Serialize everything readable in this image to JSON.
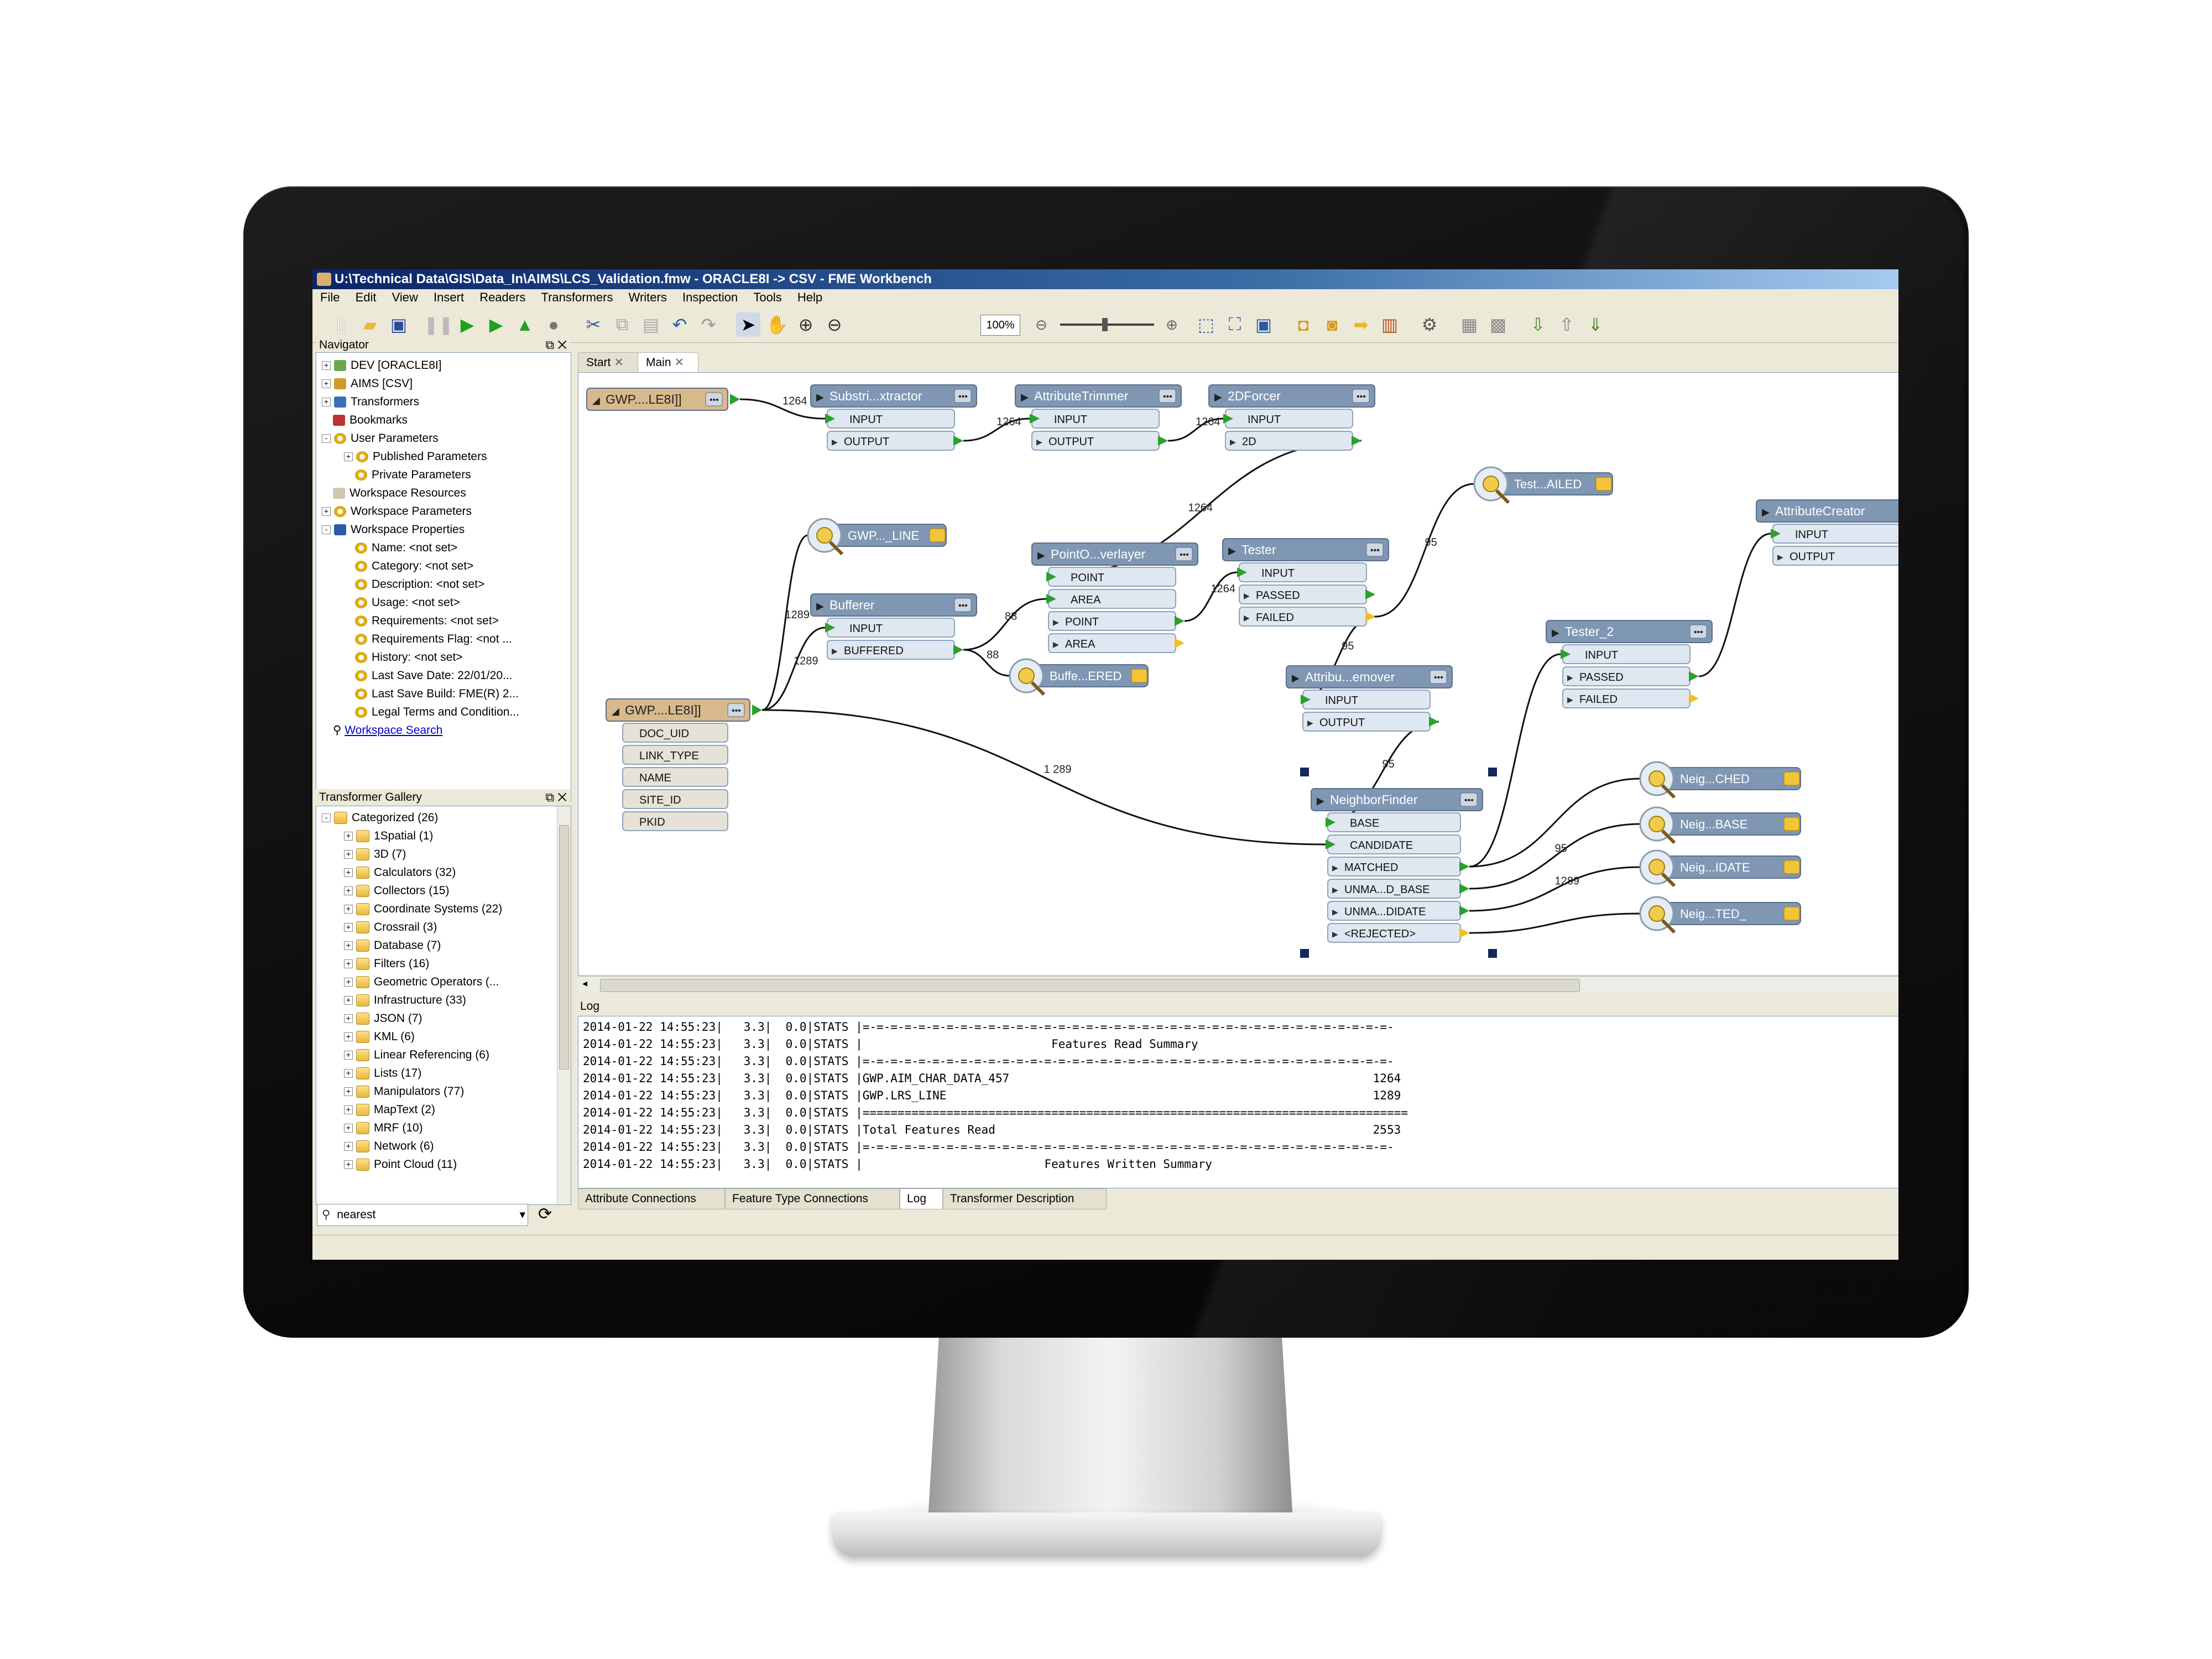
{
  "window": {
    "title": "U:\\Technical Data\\GIS\\Data_In\\AIMS\\LCS_Validation.fmw - ORACLE8I -> CSV - FME Workbench"
  },
  "menu": [
    "File",
    "Edit",
    "View",
    "Insert",
    "Readers",
    "Transformers",
    "Writers",
    "Inspection",
    "Tools",
    "Help"
  ],
  "toolbar": {
    "zoom_value": "100%",
    "icons": [
      "new-icon",
      "open-icon",
      "save-icon",
      "pause-icon",
      "run-icon",
      "run-to-icon",
      "run-partial-icon",
      "stop-icon",
      "cut-icon",
      "copy-icon",
      "paste-icon",
      "undo-icon",
      "redo-icon",
      "select-icon",
      "pan-icon",
      "zoom-in-icon",
      "zoom-out-icon",
      "zoom-extents-icon",
      "zoom-fit-icon",
      "zoom-window-icon",
      "add-reader-icon",
      "add-writer-icon",
      "add-transformer-icon",
      "add-bookmark-icon",
      "inspect-icon",
      "align-icon",
      "distribute-icon",
      "import-icon",
      "export-icon",
      "publish-icon"
    ]
  },
  "navigator": {
    "title": "Navigator",
    "items": [
      {
        "label": "DEV [ORACLE8I]",
        "indent": 0,
        "icon": "reader",
        "exp": "+"
      },
      {
        "label": "AIMS [CSV]",
        "indent": 0,
        "icon": "writer",
        "exp": "+"
      },
      {
        "label": "Transformers",
        "indent": 0,
        "icon": "transf",
        "exp": "+"
      },
      {
        "label": "Bookmarks",
        "indent": 0,
        "icon": "book",
        "exp": ""
      },
      {
        "label": "User Parameters",
        "indent": 0,
        "icon": "gear",
        "exp": "-"
      },
      {
        "label": "Published Parameters",
        "indent": 1,
        "icon": "gear",
        "exp": "+"
      },
      {
        "label": "Private Parameters",
        "indent": 1,
        "icon": "gear",
        "exp": ""
      },
      {
        "label": "Workspace Resources",
        "indent": 0,
        "icon": "doc",
        "exp": ""
      },
      {
        "label": "Workspace Parameters",
        "indent": 0,
        "icon": "gear",
        "exp": "+"
      },
      {
        "label": "Workspace Properties",
        "indent": 0,
        "icon": "info",
        "exp": "-"
      },
      {
        "label": "Name: <not set>",
        "indent": 1,
        "icon": "gear",
        "exp": ""
      },
      {
        "label": "Category: <not set>",
        "indent": 1,
        "icon": "gear",
        "exp": ""
      },
      {
        "label": "Description: <not set>",
        "indent": 1,
        "icon": "gear",
        "exp": ""
      },
      {
        "label": "Usage: <not set>",
        "indent": 1,
        "icon": "gear",
        "exp": ""
      },
      {
        "label": "Requirements: <not set>",
        "indent": 1,
        "icon": "gear",
        "exp": ""
      },
      {
        "label": "Requirements Flag: <not ...",
        "indent": 1,
        "icon": "gear",
        "exp": ""
      },
      {
        "label": "History: <not set>",
        "indent": 1,
        "icon": "gear",
        "exp": ""
      },
      {
        "label": "Last Save Date: 22/01/20...",
        "indent": 1,
        "icon": "gear",
        "exp": ""
      },
      {
        "label": "Last Save Build: FME(R) 2...",
        "indent": 1,
        "icon": "gear",
        "exp": ""
      },
      {
        "label": "Legal Terms and Condition...",
        "indent": 1,
        "icon": "gear",
        "exp": ""
      }
    ],
    "search_link": "Workspace Search"
  },
  "gallery": {
    "title": "Transformer Gallery",
    "root": "Categorized (26)",
    "items": [
      "1Spatial (1)",
      "3D (7)",
      "Calculators (32)",
      "Collectors (15)",
      "Coordinate Systems (22)",
      "Crossrail (3)",
      "Database (7)",
      "Filters (16)",
      "Geometric Operators (...",
      "Infrastructure (33)",
      "JSON (7)",
      "KML (6)",
      "Linear Referencing (6)",
      "Lists (17)",
      "Manipulators (77)",
      "MapText (2)",
      "MRF (10)",
      "Network (6)",
      "Point Cloud (11)"
    ],
    "search_value": "nearest"
  },
  "tabs": [
    "Start",
    "Main"
  ],
  "workflow": {
    "nodes": [
      {
        "id": "reader1",
        "title": "GWP....LE8I]]",
        "kind": "reader",
        "ports": []
      },
      {
        "id": "substr",
        "title": "Substri...xtractor",
        "kind": "transformer",
        "ports": [
          "INPUT",
          "OUTPUT"
        ]
      },
      {
        "id": "attrtrim",
        "title": "AttributeTrimmer",
        "kind": "transformer",
        "ports": [
          "INPUT",
          "OUTPUT"
        ]
      },
      {
        "id": "forcer",
        "title": "2DForcer",
        "kind": "transformer",
        "ports": [
          "INPUT",
          "2D"
        ]
      },
      {
        "id": "insp1",
        "title": "GWP..._LINE",
        "kind": "inspector",
        "ports": []
      },
      {
        "id": "buffer",
        "title": "Bufferer",
        "kind": "transformer",
        "ports": [
          "INPUT",
          "BUFFERED"
        ]
      },
      {
        "id": "overlay",
        "title": "PointO...verlayer",
        "kind": "transformer",
        "ports": [
          "POINT",
          "AREA",
          "POINT",
          "AREA"
        ]
      },
      {
        "id": "tester",
        "title": "Tester",
        "kind": "transformer",
        "ports": [
          "INPUT",
          "PASSED",
          "FAILED"
        ]
      },
      {
        "id": "inspfail",
        "title": "Test...AILED",
        "kind": "inspector",
        "ports": []
      },
      {
        "id": "inspbuf",
        "title": "Buffe...ERED",
        "kind": "inspector",
        "ports": []
      },
      {
        "id": "attrrem",
        "title": "Attribu...emover",
        "kind": "transformer",
        "ports": [
          "INPUT",
          "OUTPUT"
        ]
      },
      {
        "id": "reader2",
        "title": "GWP....LE8I]]",
        "kind": "reader",
        "ports": [
          "DOC_UID",
          "LINK_TYPE",
          "NAME",
          "SITE_ID",
          "PKID"
        ]
      },
      {
        "id": "tester2",
        "title": "Tester_2",
        "kind": "transformer",
        "ports": [
          "INPUT",
          "PASSED",
          "FAILED"
        ]
      },
      {
        "id": "creator",
        "title": "AttributeCreator",
        "kind": "transformer",
        "ports": [
          "INPUT",
          "OUTPUT"
        ]
      },
      {
        "id": "neigh",
        "title": "NeighborFinder",
        "kind": "transformer",
        "ports": [
          "BASE",
          "CANDIDATE",
          "MATCHED",
          "UNMA...D_BASE",
          "UNMA...DIDATE",
          "<REJECTED>"
        ]
      },
      {
        "id": "insp_ched",
        "title": "Neig...CHED",
        "kind": "inspector",
        "ports": []
      },
      {
        "id": "insp_base",
        "title": "Neig...BASE",
        "kind": "inspector",
        "ports": []
      },
      {
        "id": "insp_idate",
        "title": "Neig...IDATE",
        "kind": "inspector",
        "ports": []
      },
      {
        "id": "insp_ted",
        "title": "Neig...TED_",
        "kind": "inspector",
        "ports": []
      }
    ],
    "edge_labels": [
      "1264",
      "1264",
      "1264",
      "1264",
      "1289",
      "1289",
      "88",
      "88",
      "1264",
      "95",
      "95",
      "1 289",
      "95",
      "95",
      "1289"
    ]
  },
  "log": {
    "title": "Log",
    "lines": [
      "2014-01-22 14:55:23|   3.3|  0.0|STATS |=-=-=-=-=-=-=-=-=-=-=-=-=-=-=-=-=-=-=-=-=-=-=-=-=-=-=-=-=-=-=-=-=-=-=-=-=-=-",
      "2014-01-22 14:55:23|   3.3|  0.0|STATS |                           Features Read Summary",
      "2014-01-22 14:55:23|   3.3|  0.0|STATS |=-=-=-=-=-=-=-=-=-=-=-=-=-=-=-=-=-=-=-=-=-=-=-=-=-=-=-=-=-=-=-=-=-=-=-=-=-=-",
      "2014-01-22 14:55:23|   3.3|  0.0|STATS |GWP.AIM_CHAR_DATA_457                                                    1264",
      "2014-01-22 14:55:23|   3.3|  0.0|STATS |GWP.LRS_LINE                                                             1289",
      "2014-01-22 14:55:23|   3.3|  0.0|STATS |==============================================================================",
      "2014-01-22 14:55:23|   3.3|  0.0|STATS |Total Features Read                                                      2553",
      "2014-01-22 14:55:23|   3.3|  0.0|STATS |=-=-=-=-=-=-=-=-=-=-=-=-=-=-=-=-=-=-=-=-=-=-=-=-=-=-=-=-=-=-=-=-=-=-=-=-=-=-",
      "2014-01-22 14:55:23|   3.3|  0.0|STATS |                          Features Written Summary"
    ]
  },
  "bottom_tabs": [
    "Attribute Connections",
    "Feature Type Connections",
    "Log",
    "Transformer Description"
  ],
  "colors": {
    "title_start": "#0a246a",
    "node_header": "#7f97b3",
    "port_fill": "#dfe7f1",
    "reader_header": "#d8b98c",
    "arrow_green": "#2aa12a",
    "inspector_yellow": "#f3c43a"
  }
}
